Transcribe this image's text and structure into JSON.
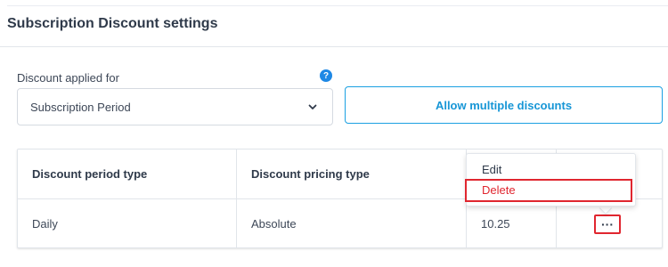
{
  "section": {
    "title": "Subscription Discount settings"
  },
  "discount_applied": {
    "label": "Discount applied for",
    "help_icon": "?",
    "selected_value": "Subscription Period"
  },
  "allow_multiple_button": {
    "label": "Allow multiple discounts"
  },
  "table": {
    "headers": [
      "Discount period type",
      "Discount pricing type",
      "",
      ""
    ],
    "rows": [
      {
        "period_type": "Daily",
        "pricing_type": "Absolute",
        "amount": "10.25",
        "actions_label": "···"
      }
    ]
  },
  "row_menu": {
    "items": [
      "Edit",
      "Delete"
    ]
  },
  "colors": {
    "accent": "#1ba0e2",
    "danger": "#e0262f",
    "help": "#1e88e5"
  }
}
